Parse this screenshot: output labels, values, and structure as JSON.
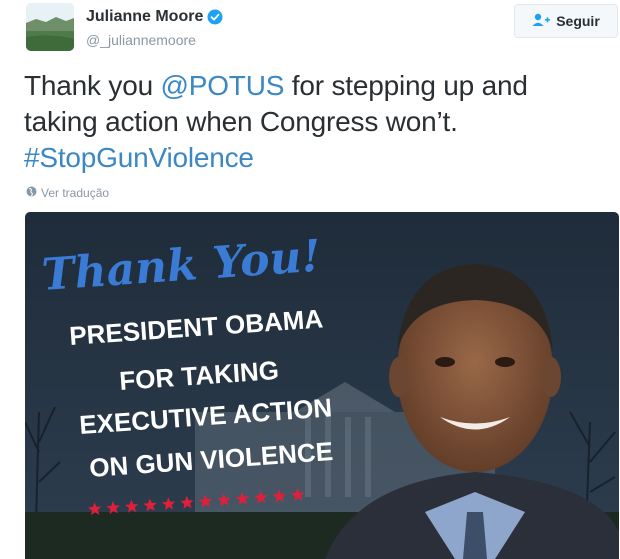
{
  "user": {
    "display_name": "Julianne Moore",
    "handle": "@_juliannemoore",
    "avatar_icon": "landscape-avatar",
    "verified_icon": "verified-badge-icon"
  },
  "follow_button": {
    "label": "Seguir",
    "icon": "add-user-icon"
  },
  "tweet": {
    "text_before": "Thank you ",
    "mention": "@POTUS",
    "text_after": " for stepping up and taking action when Congress won’t. ",
    "hashtag": "#StopGunViolence"
  },
  "translate_link": {
    "label": "Ver tradução",
    "icon": "globe-icon"
  },
  "media": {
    "headline": "Thank You!",
    "line1": "PRESIDENT OBAMA",
    "line2": "FOR TAKING",
    "line3": "EXECUTIVE ACTION",
    "line4": "ON GUN VIOLENCE",
    "star_count": 12
  },
  "colors": {
    "link": "#3b88c3",
    "verified": "#1da1f2",
    "headline_blue": "#3a7bd5",
    "stars": "#e0203a"
  }
}
